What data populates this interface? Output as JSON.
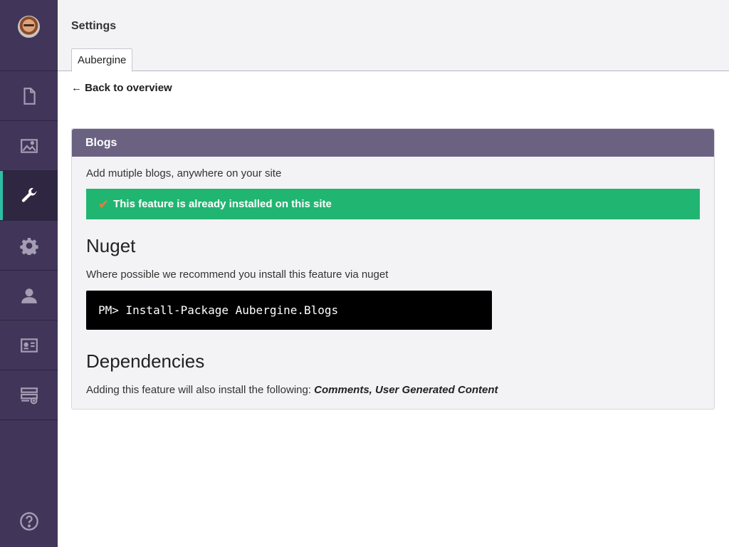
{
  "header": {
    "title": "Settings",
    "tab_label": "Aubergine"
  },
  "sidebar": {
    "items": [
      {
        "name": "content",
        "icon": "document-icon"
      },
      {
        "name": "media",
        "icon": "image-icon"
      },
      {
        "name": "settings-tools",
        "icon": "wrench-icon",
        "active": true
      },
      {
        "name": "developer",
        "icon": "gear-icon"
      },
      {
        "name": "users",
        "icon": "user-icon"
      },
      {
        "name": "members",
        "icon": "id-card-icon"
      },
      {
        "name": "forms",
        "icon": "form-add-icon"
      }
    ],
    "help_icon": "help-icon"
  },
  "main": {
    "back_label": "← Back to overview",
    "panel": {
      "title": "Blogs",
      "description": "Add mutiple blogs, anywhere on your site",
      "installed_check": "✔",
      "installed_text": "This feature is already installed on this site",
      "nuget_heading": "Nuget",
      "nuget_description": "Where possible we recommend you install this feature via nuget",
      "nuget_command": "PM> Install-Package Aubergine.Blogs",
      "deps_heading": "Dependencies",
      "deps_prefix": "Adding this feature will also install the following: ",
      "deps_list": "Comments, User Generated Content"
    }
  },
  "colors": {
    "sidebar": "#413659",
    "sidebar_active_accent": "#2bc0a6",
    "panel_header": "#6b6281",
    "success": "#21b572",
    "check": "#f07a3a"
  }
}
